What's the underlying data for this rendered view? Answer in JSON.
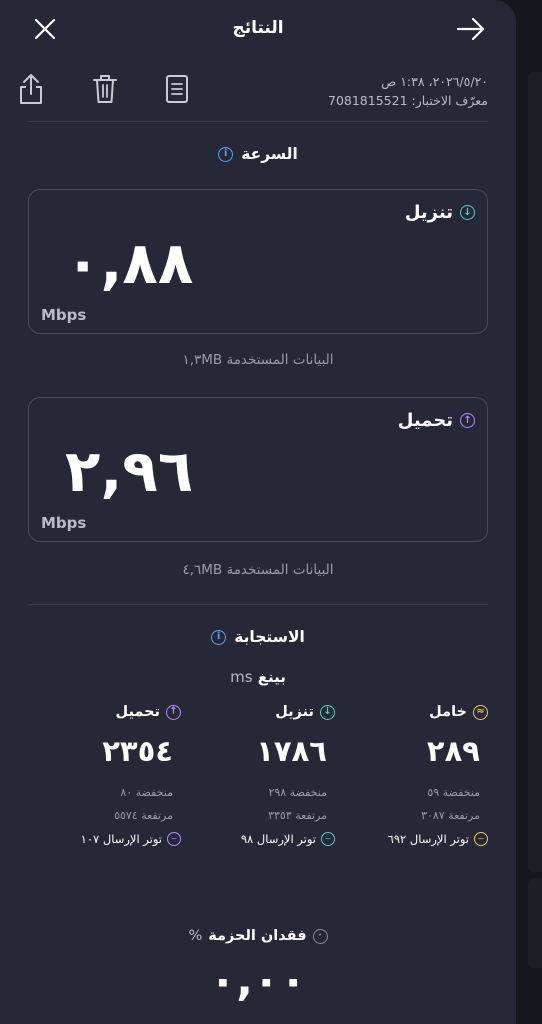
{
  "header": {
    "title": "النتائج"
  },
  "meta": {
    "datetime": "٢٠٢٦/٥/٢٠، ١:٣٨ ص",
    "test_id": "معرّف الاختبار: 7081815521"
  },
  "speed": {
    "title": "السرعة",
    "download": {
      "label": "تنزيل",
      "value": "٠,٨٨",
      "unit": "Mbps",
      "data_used": "البيانات المستخدمة ١,٣MB"
    },
    "upload": {
      "label": "تحميل",
      "value": "٢,٩٦",
      "unit": "Mbps",
      "data_used": "البيانات المستخدمة ٤,٦MB"
    }
  },
  "responsiveness": {
    "title": "الاستجابة",
    "ping_label": "بينغ",
    "ping_unit": "ms",
    "unloaded": {
      "label": "خامل",
      "value": "٢٨٩",
      "low": "منخفضة ٥٩",
      "high": "مرتفعة ٣٠٨٧",
      "jitter": "توتر الإرسال ٦٩٢"
    },
    "download": {
      "label": "تنزيل",
      "value": "١٧٨٦",
      "low": "منخفضة ٢٩٨",
      "high": "مرتفعة ٣٣٥٣",
      "jitter": "توتر الإرسال ٩٨"
    },
    "upload": {
      "label": "تحميل",
      "value": "٢٣٥٤",
      "low": "منخفضة ٨٠",
      "high": "مرتفعة ٥٥٧٤",
      "jitter": "توتر الإرسال ١٠٧"
    }
  },
  "packet_loss": {
    "label": "فقدان الحزمة",
    "unit": "%",
    "value": "٠,٠٠"
  },
  "colors": {
    "panel": "#262737",
    "download_accent": "#4fd1bf",
    "upload_accent": "#b58cff",
    "unloaded_accent": "#f2c64a",
    "info_accent": "#5aa2f5"
  },
  "icons": [
    "close-icon",
    "arrow-right-icon",
    "share-icon",
    "trash-icon",
    "report-icon",
    "info-icon",
    "download-arrow-icon",
    "upload-arrow-icon",
    "idle-icon",
    "jitter-icon",
    "packet-loss-icon"
  ]
}
